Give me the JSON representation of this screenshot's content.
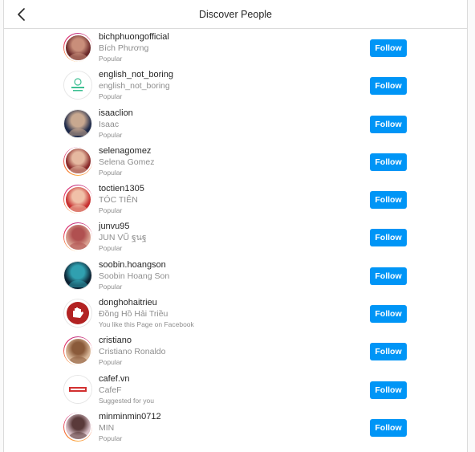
{
  "header": {
    "title": "Discover People",
    "back_icon": "chevron-left-icon"
  },
  "follow_label": "Follow",
  "accent_color": "#0095f6",
  "users": [
    {
      "username": "bichphuongofficial",
      "fullname": "Bích Phương",
      "reason": "Popular",
      "ring": true,
      "avatar": "photo"
    },
    {
      "username": "english_not_boring",
      "fullname": "english_not_boring",
      "reason": "Popular",
      "ring": false,
      "avatar": "logo-green"
    },
    {
      "username": "isaaclion",
      "fullname": "Isaac",
      "reason": "Popular",
      "ring": false,
      "avatar": "photo"
    },
    {
      "username": "selenagomez",
      "fullname": "Selena Gomez",
      "reason": "Popular",
      "ring": true,
      "avatar": "photo"
    },
    {
      "username": "toctien1305",
      "fullname": "TÓC TIÊN",
      "reason": "Popular",
      "ring": true,
      "avatar": "photo"
    },
    {
      "username": "junvu95",
      "fullname": "JUN VŨ ฐนฐ",
      "reason": "Popular",
      "ring": true,
      "avatar": "photo"
    },
    {
      "username": "soobin.hoangson",
      "fullname": "Soobin Hoang Son",
      "reason": "Popular",
      "ring": false,
      "avatar": "photo"
    },
    {
      "username": "donghohaitrieu",
      "fullname": "Đồng Hồ Hải Triều",
      "reason": "You like this Page on Facebook",
      "ring": false,
      "avatar": "logo-hand"
    },
    {
      "username": "cristiano",
      "fullname": "Cristiano Ronaldo",
      "reason": "Popular",
      "ring": true,
      "avatar": "photo"
    },
    {
      "username": "cafef.vn",
      "fullname": "CafeF",
      "reason": "Suggested for you",
      "ring": false,
      "avatar": "logo-cafef"
    },
    {
      "username": "minminmin0712",
      "fullname": "MIN",
      "reason": "Popular",
      "ring": true,
      "avatar": "photo"
    }
  ]
}
